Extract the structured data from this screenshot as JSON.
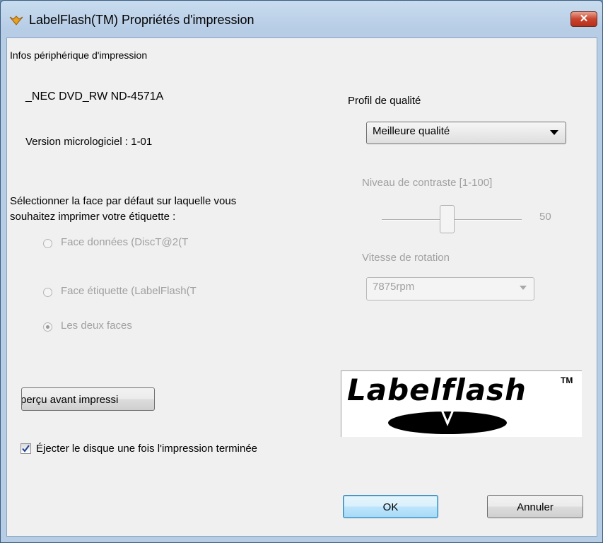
{
  "window": {
    "title": "LabelFlash(TM) Propriétés d'impression"
  },
  "device": {
    "section_label": "Infos périphérique d'impression",
    "name": "_NEC DVD_RW ND-4571A",
    "firmware": "Version micrologiciel : 1-01"
  },
  "face": {
    "prompt_line1": "Sélectionner la face par défaut sur laquelle vous",
    "prompt_line2": "souhaitez imprimer votre étiquette :",
    "options": [
      {
        "label": "Face données (DiscT@2(T",
        "selected": false
      },
      {
        "label": "Face étiquette (LabelFlash(T",
        "selected": false
      },
      {
        "label": "Les deux faces",
        "selected": true
      }
    ]
  },
  "quality": {
    "label": "Profil de qualité",
    "value": "Meilleure qualité"
  },
  "contrast": {
    "label": "Niveau de contraste [1-100]",
    "value": "50",
    "level": 50
  },
  "rotation": {
    "label": "Vitesse de rotation",
    "value": "7875rpm"
  },
  "preview_button": "perçu avant impressi",
  "eject": {
    "label": "Éjecter le disque une fois l'impression terminée",
    "checked": true
  },
  "logo": {
    "text": "Labelflash",
    "tm": "TM"
  },
  "buttons": {
    "ok": "OK",
    "cancel": "Annuler"
  },
  "colors": {
    "disabled_text": "#a0a0a0",
    "default_button_border": "#3c7fb1",
    "close_button": "#c9432d"
  }
}
